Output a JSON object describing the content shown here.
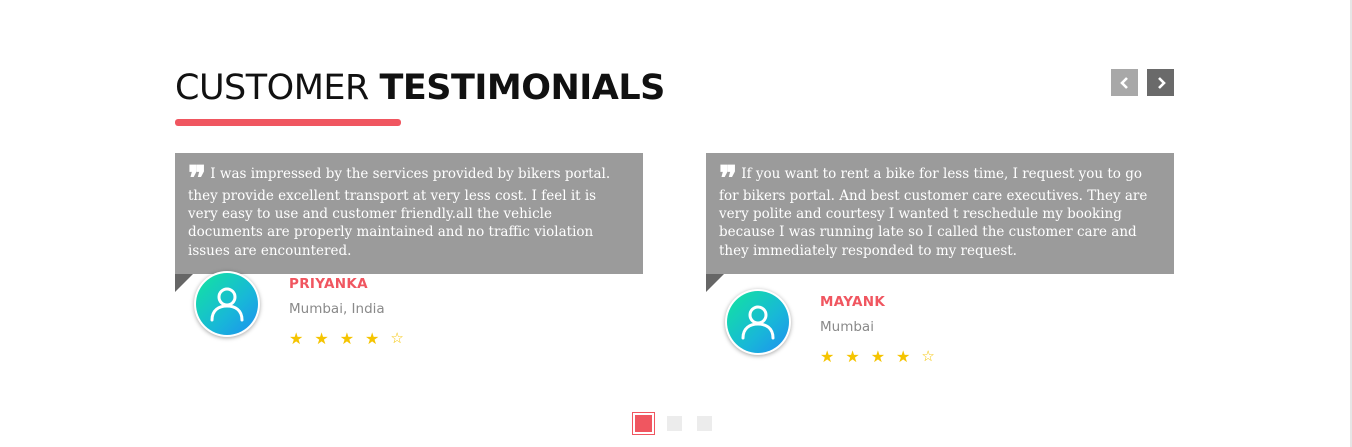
{
  "section": {
    "title_light": "CUSTOMER",
    "title_bold": "TESTIMONIALS",
    "accent_color": "#f05660"
  },
  "nav": {
    "prev_icon": "chevron-left-icon",
    "next_icon": "chevron-right-icon"
  },
  "testimonials": [
    {
      "quote_mark": "❞",
      "text": "I was impressed by the services provided by bikers portal. they provide excellent transport at very less cost. I feel it is very easy to use and customer friendly.all the vehicle documents are properly maintained and no traffic violation issues are encountered.",
      "name": "PRIYANKA",
      "location": "Mumbai, India",
      "rating": 4,
      "max_rating": 5,
      "avatar_icon": "user-icon"
    },
    {
      "quote_mark": "❞",
      "text": "If you want to rent a bike for less time, I request you to go for bikers portal. And best customer care executives. They are very polite and courtesy I wanted t reschedule my booking because I was running late so I called the customer care and they immediately responded to my request.",
      "name": "MAYANK",
      "location": "Mumbai",
      "rating": 4,
      "max_rating": 5,
      "avatar_icon": "user-icon"
    }
  ],
  "pagination": {
    "pages": 3,
    "active_index": 0
  }
}
